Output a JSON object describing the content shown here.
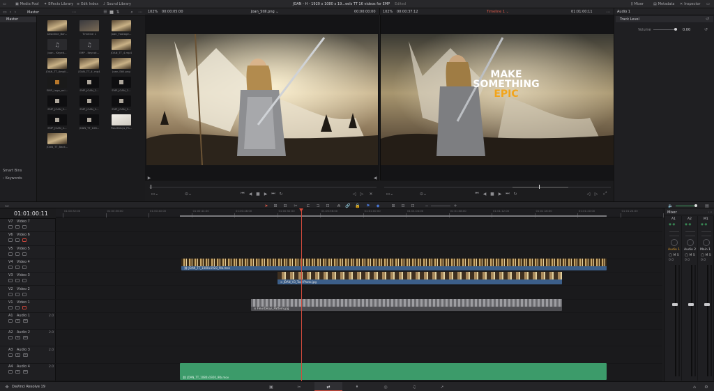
{
  "topbar": {
    "media_pool": "Media Pool",
    "effects_library": "Effects Library",
    "edit_index": "Edit Index",
    "sound_library": "Sound Library",
    "project_title": "JOAN - H - 1920 x 1080 x 19...eels TT  16 videos for EMP",
    "project_status": "Edited",
    "mixer": "Mixer",
    "metadata": "Metadata",
    "inspector": "Inspector"
  },
  "media": {
    "bin": "Master",
    "sidebar_master": "Master",
    "smart_bins": "Smart Bins",
    "keywords": "Keywords",
    "clips": [
      {
        "label": "Deadline_Bar...",
        "kind": "photo"
      },
      {
        "label": "Timeline 1",
        "kind": "timeline"
      },
      {
        "label": "Joan_Footage...",
        "kind": "photo"
      },
      {
        "label": "Joan - Keyed...",
        "kind": "audio"
      },
      {
        "label": "EMP - Keynot...",
        "kind": "audio"
      },
      {
        "label": "JOAN_TT_4.mp4",
        "kind": "photo"
      },
      {
        "label": "JOAN_TT_Ampli...",
        "kind": "photo"
      },
      {
        "label": "JOAN_TT_4..mp4",
        "kind": "photo"
      },
      {
        "label": "Joan_Still.png",
        "kind": "photo"
      },
      {
        "label": "EMP_Logo_ani...",
        "kind": "logo"
      },
      {
        "label": "EMP_JOAN_2...",
        "kind": "dark"
      },
      {
        "label": "EMP_JOAN_2...",
        "kind": "dark"
      },
      {
        "label": "EMP_JOAN_2...",
        "kind": "dark"
      },
      {
        "label": "EMP_JOAN_2...",
        "kind": "dark"
      },
      {
        "label": "EMP_JOAN_2...",
        "kind": "dark"
      },
      {
        "label": "EMP_JOAN_2...",
        "kind": "dark"
      },
      {
        "label": "JOAN_TT_108...",
        "kind": "dark"
      },
      {
        "label": "FlourDeLys_Pa...",
        "kind": "white"
      },
      {
        "label": "JOAN_TT_Back...",
        "kind": "photo"
      }
    ]
  },
  "source_viewer": {
    "zoom": "102%",
    "timecode": "00:00:05:00",
    "clip": "Joan_Still.png",
    "duration": "00:00:00:00"
  },
  "program_viewer": {
    "zoom": "102%",
    "timecode": "00:00:37:12",
    "timeline": "Timeline 1",
    "duration": "01:01:00:11",
    "overlay_line1": "MAKE",
    "overlay_line2": "SOMETHING",
    "overlay_line3": "EPIC"
  },
  "inspector": {
    "title": "Audio 1",
    "section": "Track Level",
    "volume_label": "Volume",
    "volume_value": "0.00"
  },
  "timeline": {
    "timecode": "01:01:00:11",
    "ruler": [
      "01:00:32:00",
      "01:00:36:00",
      "01:00:40:00",
      "01:00:44:00",
      "01:00:48:00",
      "01:00:52:00",
      "01:00:56:00",
      "01:01:00:00",
      "01:01:04:00",
      "01:01:08:00",
      "01:01:12:00",
      "01:01:16:00",
      "01:01:20:00",
      "01:01:24:00",
      "01:01:28:00"
    ],
    "video_tracks": [
      {
        "id": "V7",
        "name": "Video 7"
      },
      {
        "id": "V6",
        "name": "Video 6"
      },
      {
        "id": "V5",
        "name": "Video 5"
      },
      {
        "id": "V4",
        "name": "Video 4"
      },
      {
        "id": "V3",
        "name": "Video 3"
      },
      {
        "id": "V2",
        "name": "Video 2"
      },
      {
        "id": "V1",
        "name": "Video 1"
      }
    ],
    "audio_tracks": [
      {
        "id": "A1",
        "name": "Audio 1",
        "ch": "2.0"
      },
      {
        "id": "A2",
        "name": "Audio 2",
        "ch": "2.0"
      },
      {
        "id": "A3",
        "name": "Audio 3",
        "ch": "2.0"
      },
      {
        "id": "A4",
        "name": "Audio 4",
        "ch": "2.0"
      }
    ],
    "clip_v4": "JOAN_TT_1080x1920_9lb.mov",
    "clip_v3": "JOAN_V3_Tool-Photo.jpg",
    "clip_v1": "FleurDeLys_Pattern.jpg",
    "clip_a4": "JOAN_TT_1080x1920_9lb.mov"
  },
  "mixer": {
    "title": "Mixer",
    "channels": [
      "A1",
      "A2",
      "M1"
    ],
    "buses": [
      "Audio 1",
      "Audio 2",
      "Main 1"
    ],
    "values": [
      "0.0",
      "0.0",
      "0.0"
    ]
  },
  "bottombar": {
    "app": "DaVinci Resolve 19"
  }
}
